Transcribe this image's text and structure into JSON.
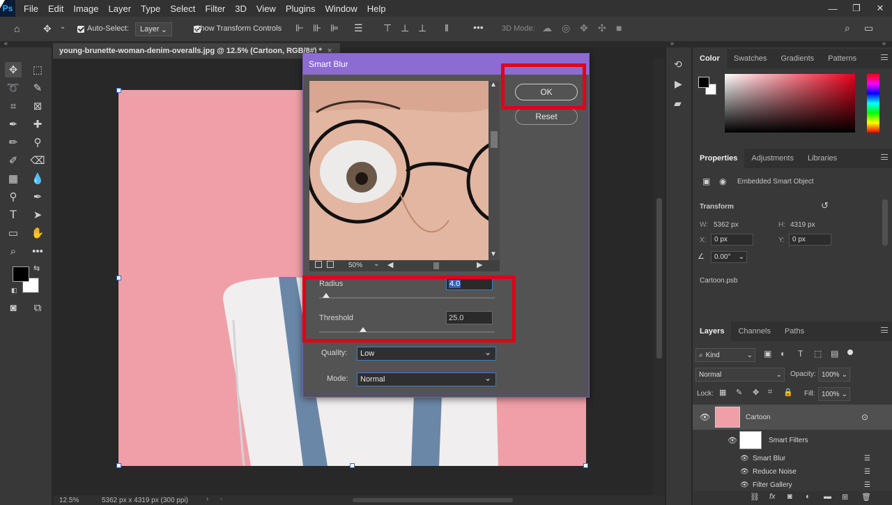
{
  "app": {
    "logo": "Ps"
  },
  "menu": [
    "File",
    "Edit",
    "Image",
    "Layer",
    "Type",
    "Select",
    "Filter",
    "3D",
    "View",
    "Plugins",
    "Window",
    "Help"
  ],
  "window_controls": {
    "minimize": "—",
    "restore": "❐",
    "close": "✕"
  },
  "options": {
    "auto_select_label": "Auto-Select:",
    "auto_select_value": "Layer",
    "show_transform_label": "Show Transform Controls",
    "mode_3d_label": "3D Mode:"
  },
  "document": {
    "tab_title": "young-brunette-woman-denim-overalls.jpg @ 12.5% (Cartoon, RGB/8#) *",
    "close": "×",
    "zoom": "12.5%",
    "size_info": "5362 px x 4319 px (300 ppi)"
  },
  "dialog": {
    "title": "Smart Blur",
    "ok_label": "OK",
    "reset_label": "Reset",
    "preview_zoom": "50%",
    "radius_label": "Radius",
    "radius_value": "4.0",
    "threshold_label": "Threshold",
    "threshold_value": "25.0",
    "radius_fraction": 0.04,
    "threshold_fraction": 0.25,
    "quality_label": "Quality:",
    "quality_value": "Low",
    "mode_label": "Mode:",
    "mode_value": "Normal"
  },
  "color_panel": {
    "tabs": [
      "Color",
      "Swatches",
      "Gradients",
      "Patterns"
    ],
    "active": "Color"
  },
  "properties_panel": {
    "tabs": [
      "Properties",
      "Adjustments",
      "Libraries"
    ],
    "active": "Properties",
    "object_type": "Embedded Smart Object",
    "transform_label": "Transform",
    "w_label": "W:",
    "w_value": "5362 px",
    "h_label": "H:",
    "h_value": "4319 px",
    "x_label": "X:",
    "x_value": "0 px",
    "y_label": "Y:",
    "y_value": "0 px",
    "angle_value": "0.00°",
    "file_name": "Cartoon.psb"
  },
  "layers_panel": {
    "tabs": [
      "Layers",
      "Channels",
      "Paths"
    ],
    "active": "Layers",
    "filter_kind": "Kind",
    "blend_mode": "Normal",
    "opacity_label": "Opacity:",
    "opacity_value": "100%",
    "lock_label": "Lock:",
    "fill_label": "Fill:",
    "fill_value": "100%",
    "layers": [
      {
        "name": "Cartoon"
      },
      {
        "name": "Smart Filters"
      },
      {
        "name": "Smart Blur"
      },
      {
        "name": "Reduce Noise"
      },
      {
        "name": "Filter Gallery"
      }
    ]
  },
  "colors": {
    "accent": "#8c6bd3",
    "highlight": "#e1001a",
    "canvas": "#f09fa8"
  }
}
